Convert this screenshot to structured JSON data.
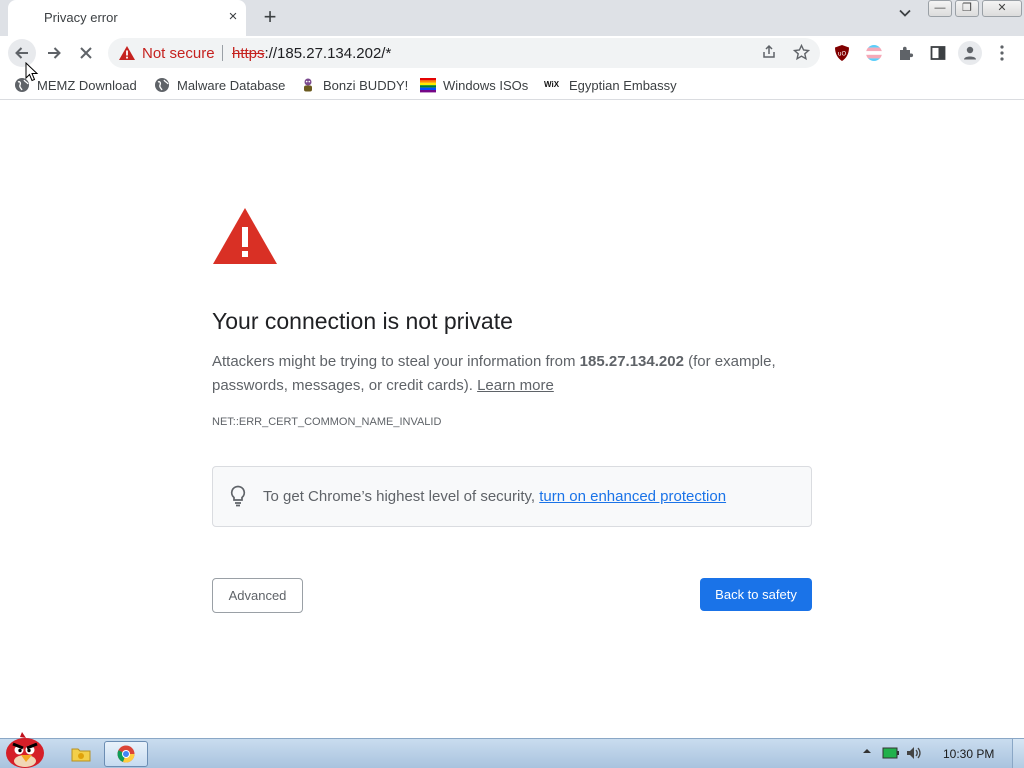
{
  "browser": {
    "tab": {
      "title": "Privacy error",
      "close_icon": "×"
    },
    "new_tab_icon": "+",
    "tab_search_icon": "⌄",
    "window_controls": [
      "—",
      "❐",
      "✕"
    ]
  },
  "toolbar": {
    "security_label": "Not secure",
    "url_scheme": "https",
    "url_rest": "://185.27.134.202/*"
  },
  "bookmarks": [
    {
      "label": "MEMZ Download",
      "icon": "globe-icon"
    },
    {
      "label": "Malware Database",
      "icon": "globe-icon"
    },
    {
      "label": "Bonzi BUDDY!",
      "icon": "bonzi-icon"
    },
    {
      "label": "Windows ISOs",
      "icon": "rainbow-flag-icon"
    },
    {
      "label": "Egyptian Embassy",
      "icon": "wix-icon",
      "icon_text": "WiX"
    }
  ],
  "interstitial": {
    "heading": "Your connection is not private",
    "para_before": "Attackers might be trying to steal your information from ",
    "host": "185.27.134.202",
    "para_after": " (for example, passwords, messages, or credit cards). ",
    "learn_more": "Learn more",
    "error_code": "NET::ERR_CERT_COMMON_NAME_INVALID",
    "enhanced_text": "To get Chrome’s highest level of security, ",
    "enhanced_link": "turn on enhanced protection",
    "advanced_button": "Advanced",
    "safety_button": "Back to safety"
  },
  "taskbar": {
    "clock": "10:30 PM"
  },
  "colors": {
    "accent": "#1a73e8",
    "danger": "#d93025",
    "not_secure": "#c5221f"
  }
}
